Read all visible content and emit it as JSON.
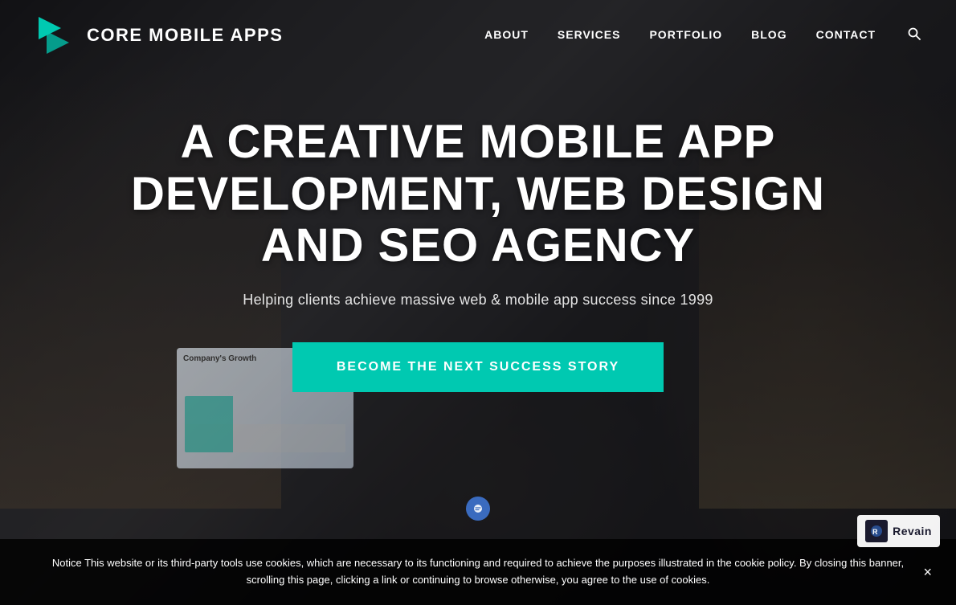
{
  "brand": {
    "name": "CORE MOBILE APPS",
    "logo_alt": "Core Mobile Apps logo"
  },
  "nav": {
    "links": [
      {
        "label": "ABOUT",
        "href": "#about"
      },
      {
        "label": "SERVICES",
        "href": "#services"
      },
      {
        "label": "PORTFOLIO",
        "href": "#portfolio"
      },
      {
        "label": "BLOG",
        "href": "#blog"
      },
      {
        "label": "CONTACT",
        "href": "#contact"
      }
    ],
    "search_aria": "Search"
  },
  "hero": {
    "title": "A CREATIVE MOBILE APP DEVELOPMENT, WEB DESIGN AND SEO AGENCY",
    "subtitle": "Helping clients achieve massive web & mobile app success since 1999",
    "cta_label": "BECOME THE NEXT SUCCESS STORY"
  },
  "cookie": {
    "notice": "Notice This website or its third-party tools use cookies, which are necessary to its functioning and required to achieve the purposes illustrated in the cookie policy. By closing this banner, scrolling this page, clicking a link or continuing to browse otherwise, you agree to the use of cookies.",
    "close_label": "×"
  },
  "revain": {
    "label": "Revain"
  },
  "colors": {
    "accent": "#00c9b1",
    "nav_bg": "transparent",
    "cookie_bg": "rgba(0,0,0,0.82)"
  }
}
